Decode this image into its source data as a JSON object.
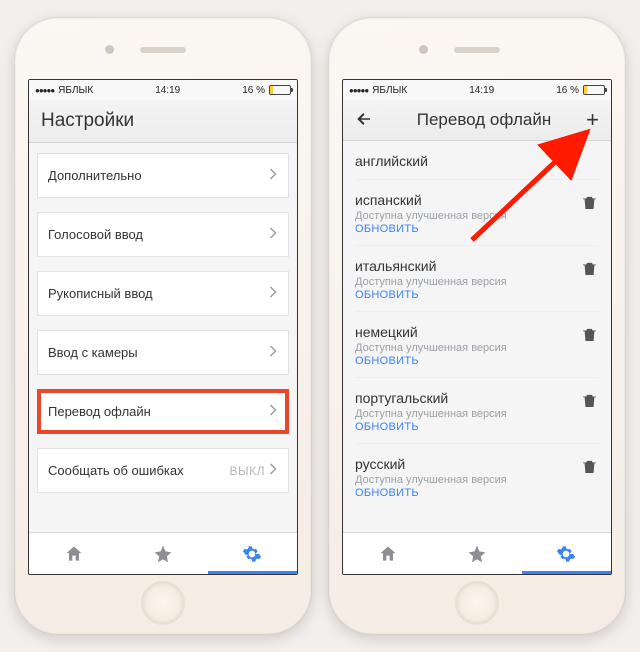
{
  "status": {
    "carrier": "ЯБЛЫК",
    "time": "14:19",
    "battery_pct": "16 %"
  },
  "left": {
    "header": {
      "title": "Настройки"
    },
    "items": [
      {
        "label": "Дополнительно"
      },
      {
        "label": "Голосовой ввод"
      },
      {
        "label": "Рукописный ввод"
      },
      {
        "label": "Ввод с камеры"
      },
      {
        "label": "Перевод офлайн",
        "highlighted": true
      },
      {
        "label": "Сообщать об ошибках",
        "toggle": "ВЫКЛ"
      }
    ]
  },
  "right": {
    "header": {
      "title": "Перевод офлайн"
    },
    "languages": [
      {
        "name": "английский"
      },
      {
        "name": "испанский",
        "sub": "Доступна улучшенная версия",
        "update": "ОБНОВИТЬ"
      },
      {
        "name": "итальянский",
        "sub": "Доступна улучшенная версия",
        "update": "ОБНОВИТЬ"
      },
      {
        "name": "немецкий",
        "sub": "Доступна улучшенная версия",
        "update": "ОБНОВИТЬ"
      },
      {
        "name": "португальский",
        "sub": "Доступна улучшенная версия",
        "update": "ОБНОВИТЬ"
      },
      {
        "name": "русский",
        "sub": "Доступна улучшенная версия",
        "update": "ОБНОВИТЬ"
      }
    ]
  },
  "tabs": {
    "home": "home",
    "star": "favorites",
    "gear": "settings"
  }
}
